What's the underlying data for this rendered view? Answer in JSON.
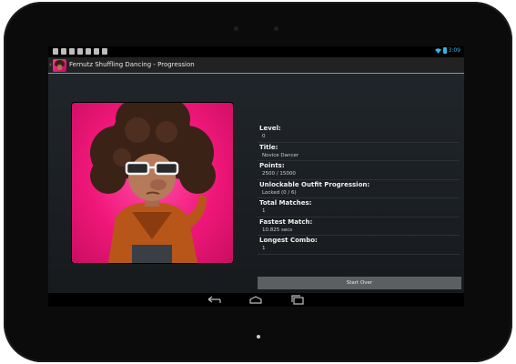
{
  "app": {
    "title": "Fernutz Shuffling Dancing - Progression"
  },
  "status_bar": {
    "time": "3:09",
    "accent_color": "#33b5e5"
  },
  "icons": {
    "status_left": [
      "notification-icon",
      "image-icon",
      "message-icon",
      "chat-icon",
      "mail-icon",
      "check-icon",
      "download-icon"
    ],
    "status_right": [
      "wifi-icon",
      "battery-icon"
    ],
    "nav": [
      "back-icon",
      "home-icon",
      "recent-apps-icon"
    ]
  },
  "stats": [
    {
      "label": "Level:",
      "value": "0"
    },
    {
      "label": "Title:",
      "value": "Novice Dancer"
    },
    {
      "label": "Points:",
      "value": "2500 / 15000"
    },
    {
      "label": "Unlockable Outfit Progression:",
      "value": "Locked (0 / 6)"
    },
    {
      "label": "Total Matches:",
      "value": "1"
    },
    {
      "label": "Fastest Match:",
      "value": "10.825 secs"
    },
    {
      "label": "Longest Combo:",
      "value": "1"
    }
  ],
  "actions": {
    "start_over": "Start Over"
  }
}
